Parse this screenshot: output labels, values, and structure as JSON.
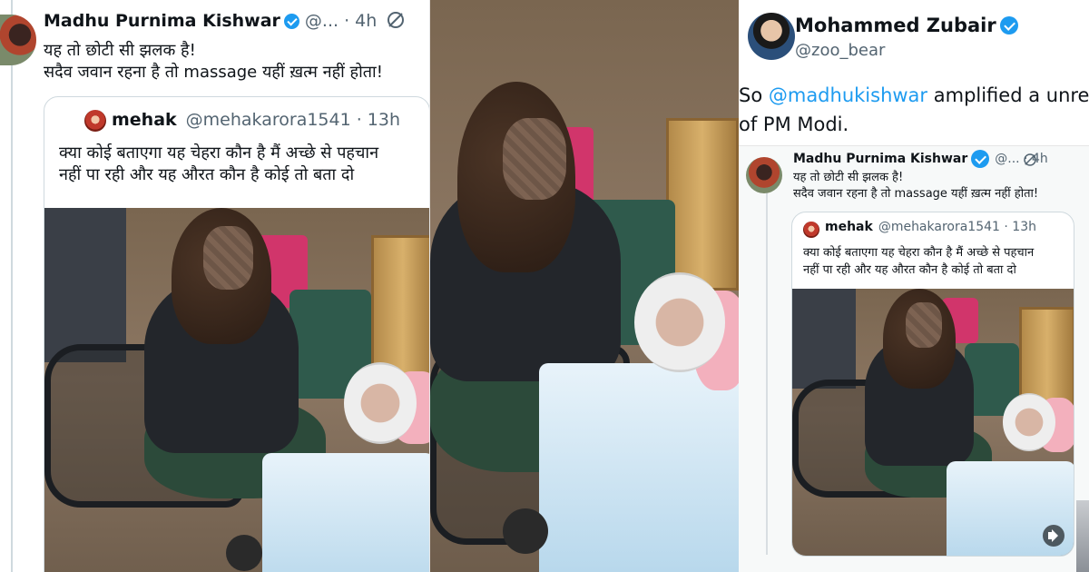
{
  "left_tweet": {
    "author_name": "Madhu Purnima Kishwar",
    "handle_time": "@... · 4h",
    "line1": "यह तो छोटी सी झलक है!",
    "line2": "सदैव जवान रहना है तो  massage यहीं ख़त्म नहीं होता!",
    "mute_icon": "mute-bell-icon",
    "quoted": {
      "author_name": "mehak",
      "handle": "@mehakarora1541 · 13h",
      "line1": "क्या कोई बताएगा यह चेहरा कौन है मैं अच्छे से पहचान",
      "line2": "नहीं पा रही और यह औरत कौन है कोई तो बता दो"
    }
  },
  "middle_photo": {
    "description_icon": "photo-frame"
  },
  "right_tweet": {
    "author_name": "Mohammed Zubair",
    "handle": "@zoo_bear",
    "text_prefix": "So ",
    "mention": "@madhukishwar",
    "text_suffix": " amplified a unrel",
    "line2": "of PM Modi.",
    "embedded": {
      "author_name": "Madhu Purnima Kishwar",
      "handle_time": "@... · 4h",
      "line1": "यह तो छोटी सी झलक है!",
      "line2": "सदैव जवान रहना है तो  massage यहीं ख़त्म नहीं होता!",
      "quoted": {
        "author_name": "mehak",
        "handle": "@mehakarora1541 · 13h",
        "line1": "क्या कोई बताएगा यह चेहरा कौन है मैं अच्छे से पहचान",
        "line2": "नहीं पा रही और यह औरत कौन है कोई तो बता दो"
      },
      "sound_icon": "speaker-icon"
    }
  },
  "colors": {
    "verified_blue": "#1d9bf0",
    "handle_gray": "#536471",
    "mention_blue": "#1d9bf0"
  }
}
